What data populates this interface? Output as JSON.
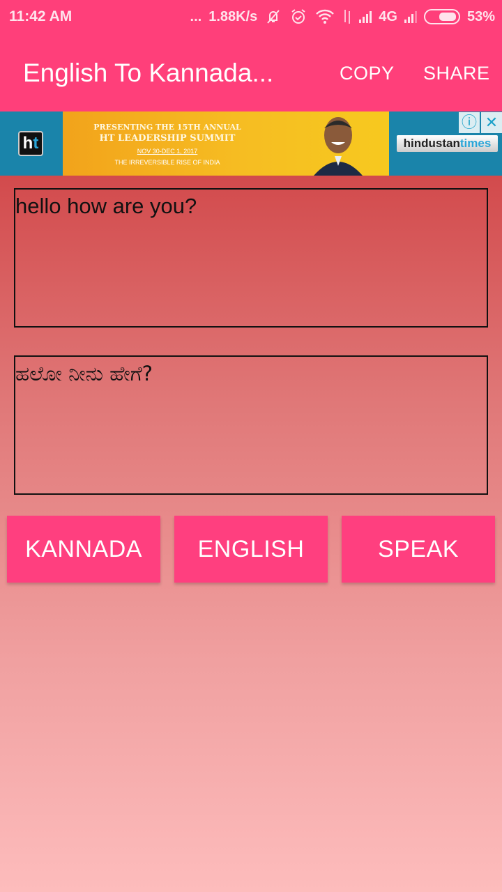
{
  "status_bar": {
    "time": "11:42 AM",
    "more": "...",
    "network_speed": "1.88K/s",
    "icons": [
      "vibrate-off-icon",
      "alarm-icon",
      "wifi-icon",
      "data-transfer-icon",
      "signal-icon",
      "signal-icon-2"
    ],
    "network_type": "4G",
    "battery_percent": "53%",
    "battery_level": 0.53
  },
  "app_bar": {
    "title": "English To Kannada...",
    "actions": [
      {
        "label": "COPY"
      },
      {
        "label": "SHARE"
      }
    ]
  },
  "ad": {
    "logo": "ht",
    "line1": "PRESENTING THE 15TH ANNUAL",
    "line2": "HT LEADERSHIP SUMMIT",
    "line3": "NOV 30-DEC 1, 2017",
    "line4": "THE IRREVERSIBLE RISE OF INDIA",
    "brand_a": "hindustan",
    "brand_b": "times",
    "info_icon": "ⓘ",
    "close_icon": "✕"
  },
  "input": {
    "source_text": "hello how are you?",
    "translated_text": "ಹಲೋ ನೀನು ಹೇಗೆ?"
  },
  "buttons": [
    {
      "label": "KANNADA"
    },
    {
      "label": "ENGLISH"
    },
    {
      "label": "SPEAK"
    }
  ],
  "colors": {
    "accent": "#ff3f7a",
    "button": "#ff3f7f",
    "background_top": "#cf3a3d",
    "background_bottom": "#fdbcbc"
  }
}
